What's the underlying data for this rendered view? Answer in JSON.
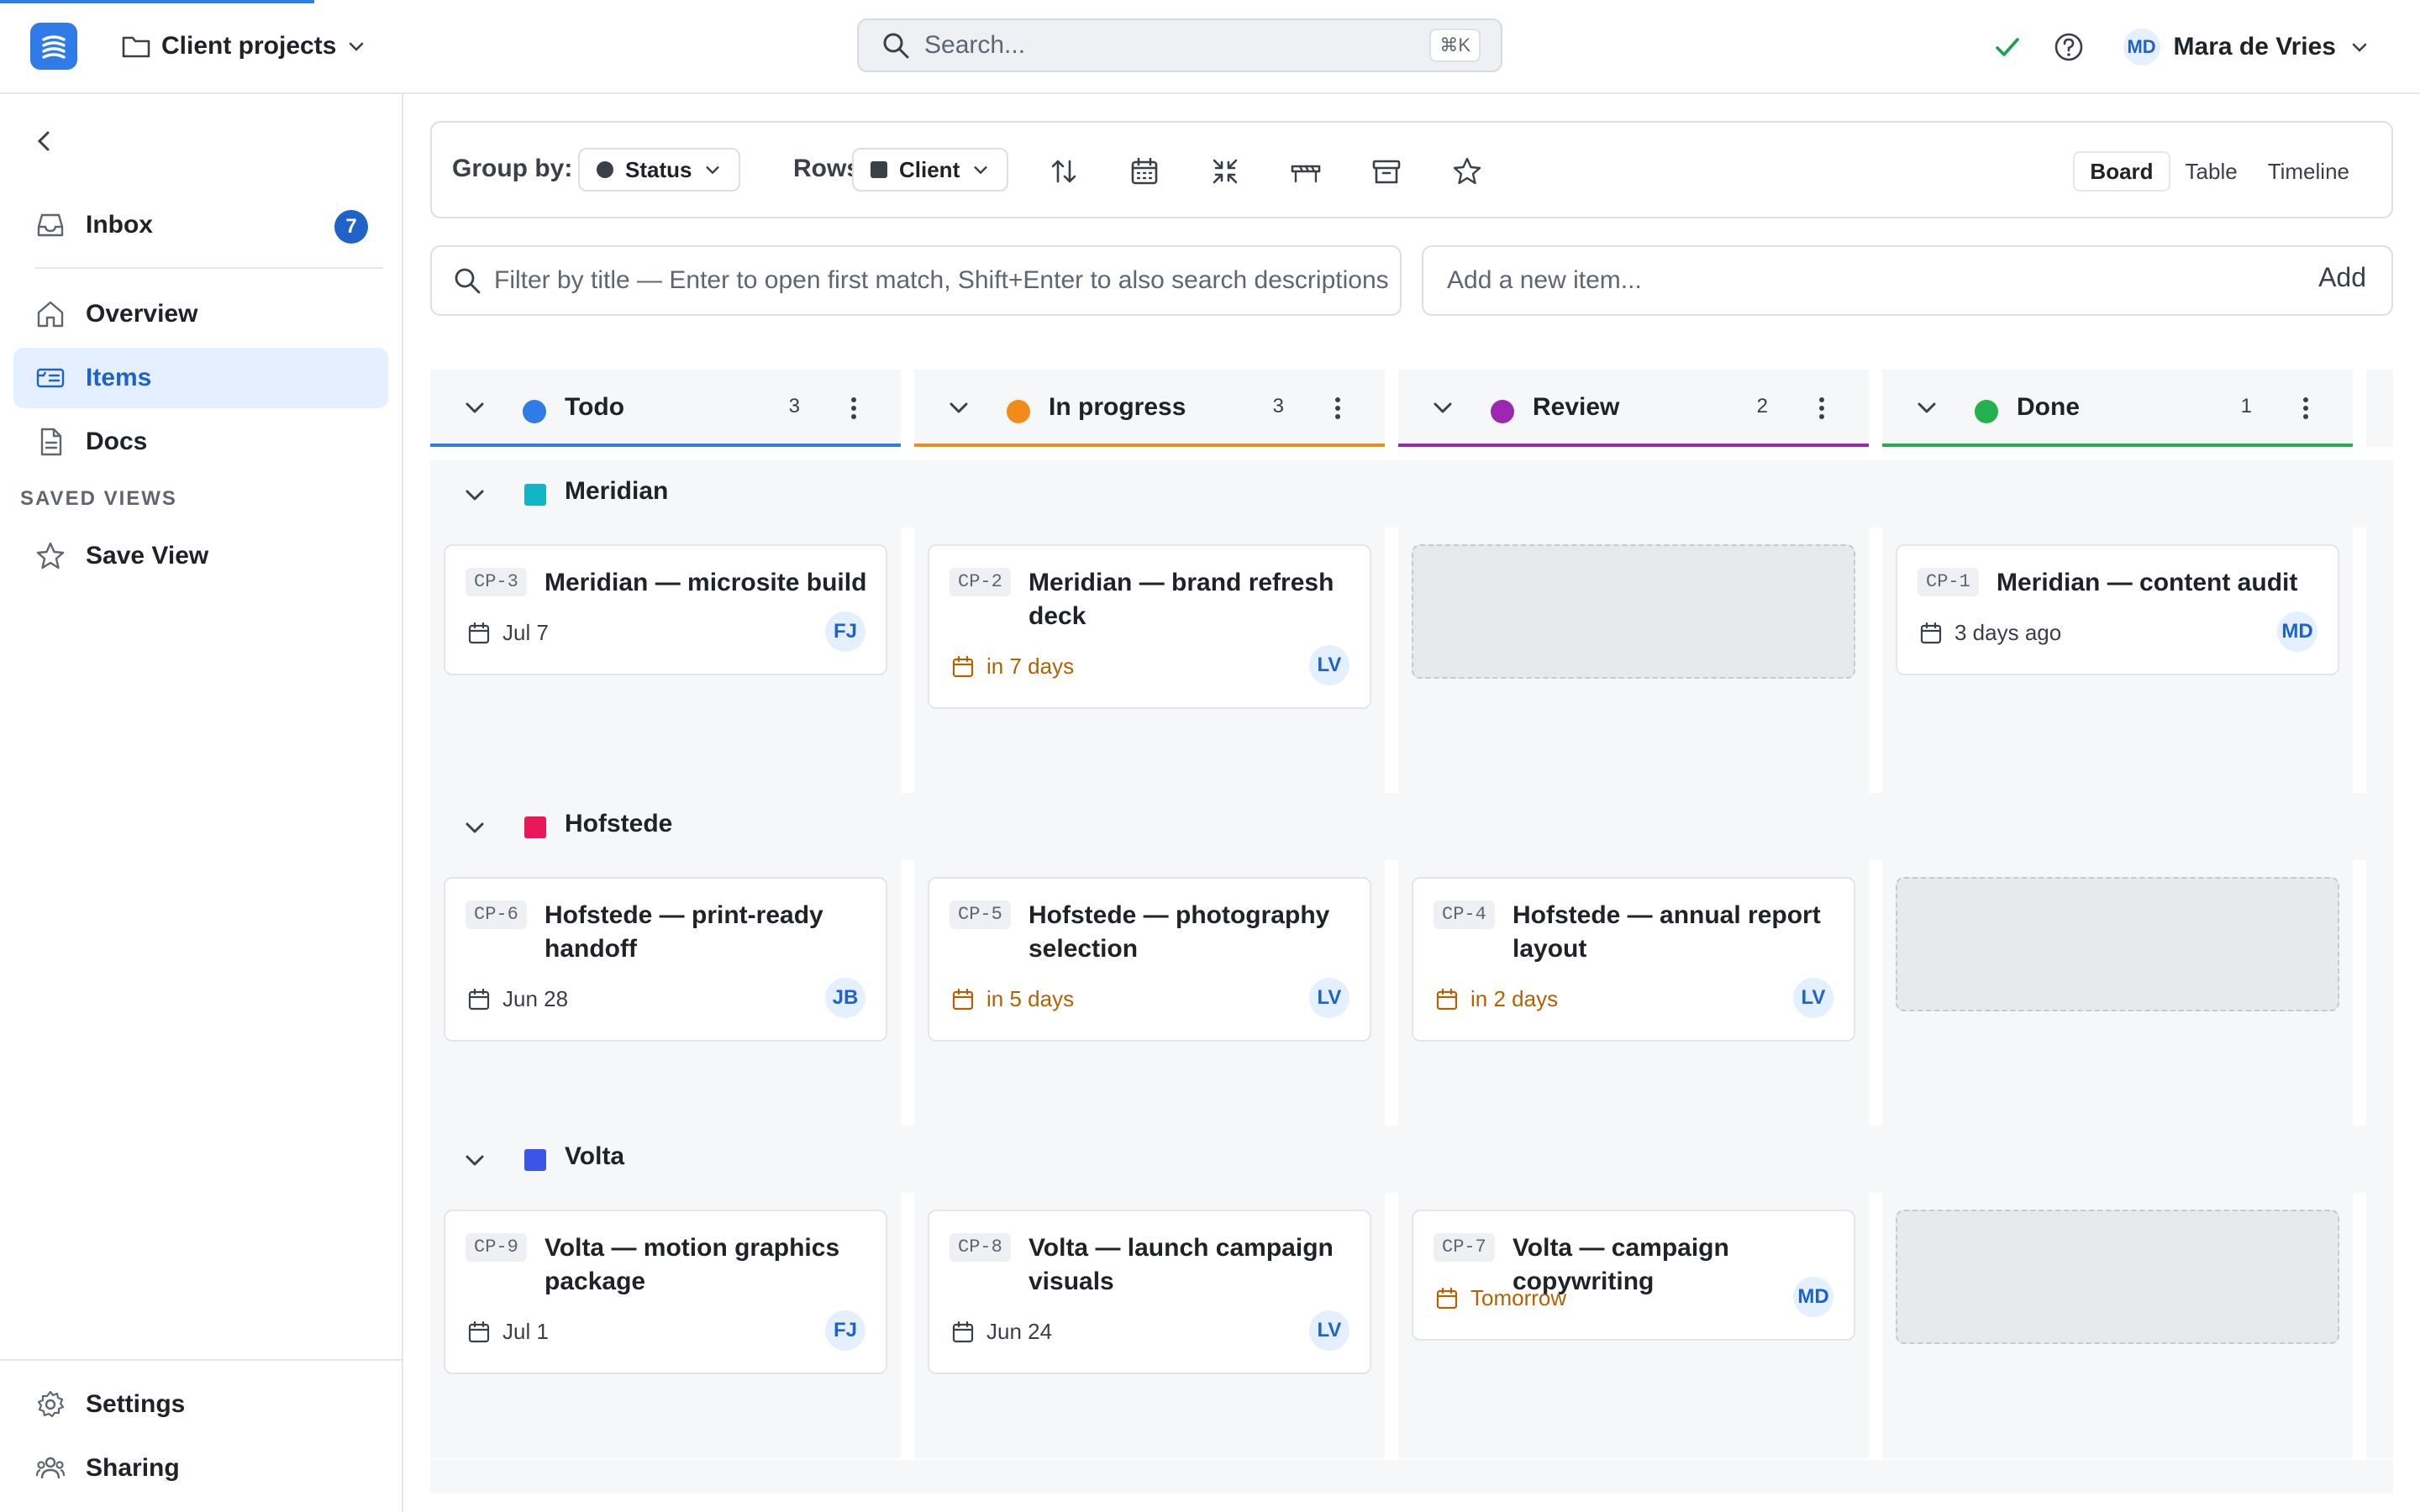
{
  "header": {
    "project_name": "Client projects",
    "search_placeholder": "Search...",
    "search_shortcut": "⌘K",
    "user_initials": "MD",
    "user_name": "Mara de Vries",
    "icons": [
      "folder-icon",
      "chevron-down-icon",
      "search-icon",
      "check-icon",
      "help-icon"
    ],
    "colors": {
      "accent": "#2f7be8",
      "sync_ok": "#16a34a"
    }
  },
  "sidebar": {
    "items": [
      {
        "label": "Inbox",
        "icon": "inbox-icon",
        "badge": "7"
      },
      {
        "label": "Overview",
        "icon": "home-icon"
      },
      {
        "label": "Items",
        "icon": "items-icon",
        "active": true
      },
      {
        "label": "Docs",
        "icon": "doc-icon"
      }
    ],
    "saved_views_title": "SAVED VIEWS",
    "saved_views": [
      {
        "label": "Save View",
        "icon": "star-icon"
      }
    ],
    "bottom": [
      {
        "label": "Settings",
        "icon": "gear-icon"
      },
      {
        "label": "Sharing",
        "icon": "people-icon"
      }
    ]
  },
  "toolbar": {
    "group_by_label": "Group by:",
    "group_by_value": "Status",
    "rows_label": "Rows:",
    "rows_value": "Client",
    "icons": [
      "sort-icon",
      "calendar-icon",
      "collapse-icon",
      "table-icon",
      "archive-icon",
      "star-icon"
    ],
    "views": [
      "Board",
      "Table",
      "Timeline"
    ],
    "active_view": "Board"
  },
  "filter": {
    "placeholder": "Filter by title — Enter to open first match, Shift+Enter to also search descriptions"
  },
  "add_item": {
    "placeholder": "Add a new item...",
    "button": "Add"
  },
  "columns": [
    {
      "title": "Todo",
      "count": "3",
      "color": "#2f7be8"
    },
    {
      "title": "In progress",
      "count": "3",
      "color": "#f08c1a"
    },
    {
      "title": "Review",
      "count": "2",
      "color": "#9c27b0"
    },
    {
      "title": "Done",
      "count": "1",
      "color": "#22b14c"
    }
  ],
  "groups": [
    {
      "name": "Meridian",
      "color": "#12b5c4",
      "cards": [
        {
          "key": "CP-3",
          "title": "Meridian — microsite build",
          "due": "Jul 7",
          "soon": false,
          "assignee": "FJ"
        },
        {
          "key": "CP-2",
          "title": "Meridian — brand refresh deck",
          "due": "in 7 days",
          "soon": true,
          "assignee": "LV"
        },
        null,
        {
          "key": "CP-1",
          "title": "Meridian — content audit",
          "due": "3 days ago",
          "soon": false,
          "assignee": "MD"
        }
      ]
    },
    {
      "name": "Hofstede",
      "color": "#e8185a",
      "cards": [
        {
          "key": "CP-6",
          "title": "Hofstede — print-ready handoff",
          "due": "Jun 28",
          "soon": false,
          "assignee": "JB"
        },
        {
          "key": "CP-5",
          "title": "Hofstede — photography selection",
          "due": "in 5 days",
          "soon": true,
          "assignee": "LV"
        },
        {
          "key": "CP-4",
          "title": "Hofstede — annual report layout",
          "due": "in 2 days",
          "soon": true,
          "assignee": "LV"
        },
        null
      ]
    },
    {
      "name": "Volta",
      "color": "#3b55e6",
      "cards": [
        {
          "key": "CP-9",
          "title": "Volta — motion graphics package",
          "due": "Jul 1",
          "soon": false,
          "assignee": "FJ"
        },
        {
          "key": "CP-8",
          "title": "Volta — launch campaign visuals",
          "due": "Jun 24",
          "soon": false,
          "assignee": "LV"
        },
        {
          "key": "CP-7",
          "title": "Volta — campaign copywriting",
          "due": "Tomorrow",
          "soon": true,
          "assignee": "MD"
        },
        null
      ]
    }
  ]
}
